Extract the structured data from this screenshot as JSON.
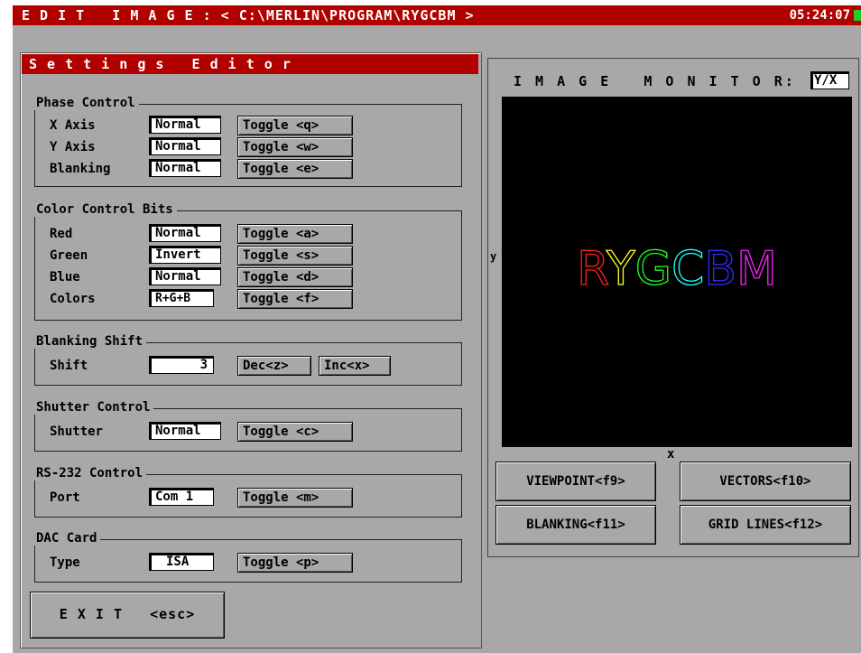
{
  "window": {
    "title": "E D I T   I M A G E : < C:\\MERLIN\\PROGRAM\\RYGCBM >",
    "clock": "05:24:07"
  },
  "settings_editor": {
    "title": "S e t t i n g s   E d i t o r",
    "phase_control": {
      "title": "Phase Control",
      "rows": [
        {
          "label": "X Axis",
          "value": "Normal",
          "button": "Toggle <q>"
        },
        {
          "label": "Y Axis",
          "value": "Normal",
          "button": "Toggle <w>"
        },
        {
          "label": "Blanking",
          "value": "Normal",
          "button": "Toggle <e>"
        }
      ]
    },
    "color_control": {
      "title": "Color Control Bits",
      "rows": [
        {
          "label": "Red",
          "value": "Normal",
          "button": "Toggle <a>"
        },
        {
          "label": "Green",
          "value": "Invert",
          "button": "Toggle <s>"
        },
        {
          "label": "Blue",
          "value": "Normal",
          "button": "Toggle <d>"
        },
        {
          "label": "Colors",
          "value": "R+G+B",
          "button": "Toggle <f>"
        }
      ]
    },
    "blanking_shift": {
      "title": "Blanking Shift",
      "label": "Shift",
      "value": "3",
      "dec_button": "Dec<z>",
      "inc_button": "Inc<x>"
    },
    "shutter_control": {
      "title": "Shutter Control",
      "label": "Shutter",
      "value": "Normal",
      "button": "Toggle <c>"
    },
    "rs232_control": {
      "title": "RS-232 Control",
      "label": "Port",
      "value": "Com 1",
      "button": "Toggle <m>"
    },
    "dac_card": {
      "title": "DAC Card",
      "label": "Type",
      "value": "ISA",
      "button": "Toggle <p>"
    },
    "exit_button": "E X I T   <esc>"
  },
  "image_monitor": {
    "title": "I M A G E   M O N I T O R:",
    "axis_mode": "Y/X",
    "y_label": "y",
    "x_label": "x",
    "display_text": "RYGCBM",
    "letter_colors": [
      "#ff2020",
      "#ffff20",
      "#20ff20",
      "#20ffff",
      "#3030ff",
      "#ff20ff"
    ],
    "buttons": {
      "viewpoint": "VIEWPOINT<f9>",
      "vectors": "VECTORS<f10>",
      "blanking": "BLANKING<f11>",
      "grid_lines": "GRID LINES<f12>"
    }
  }
}
